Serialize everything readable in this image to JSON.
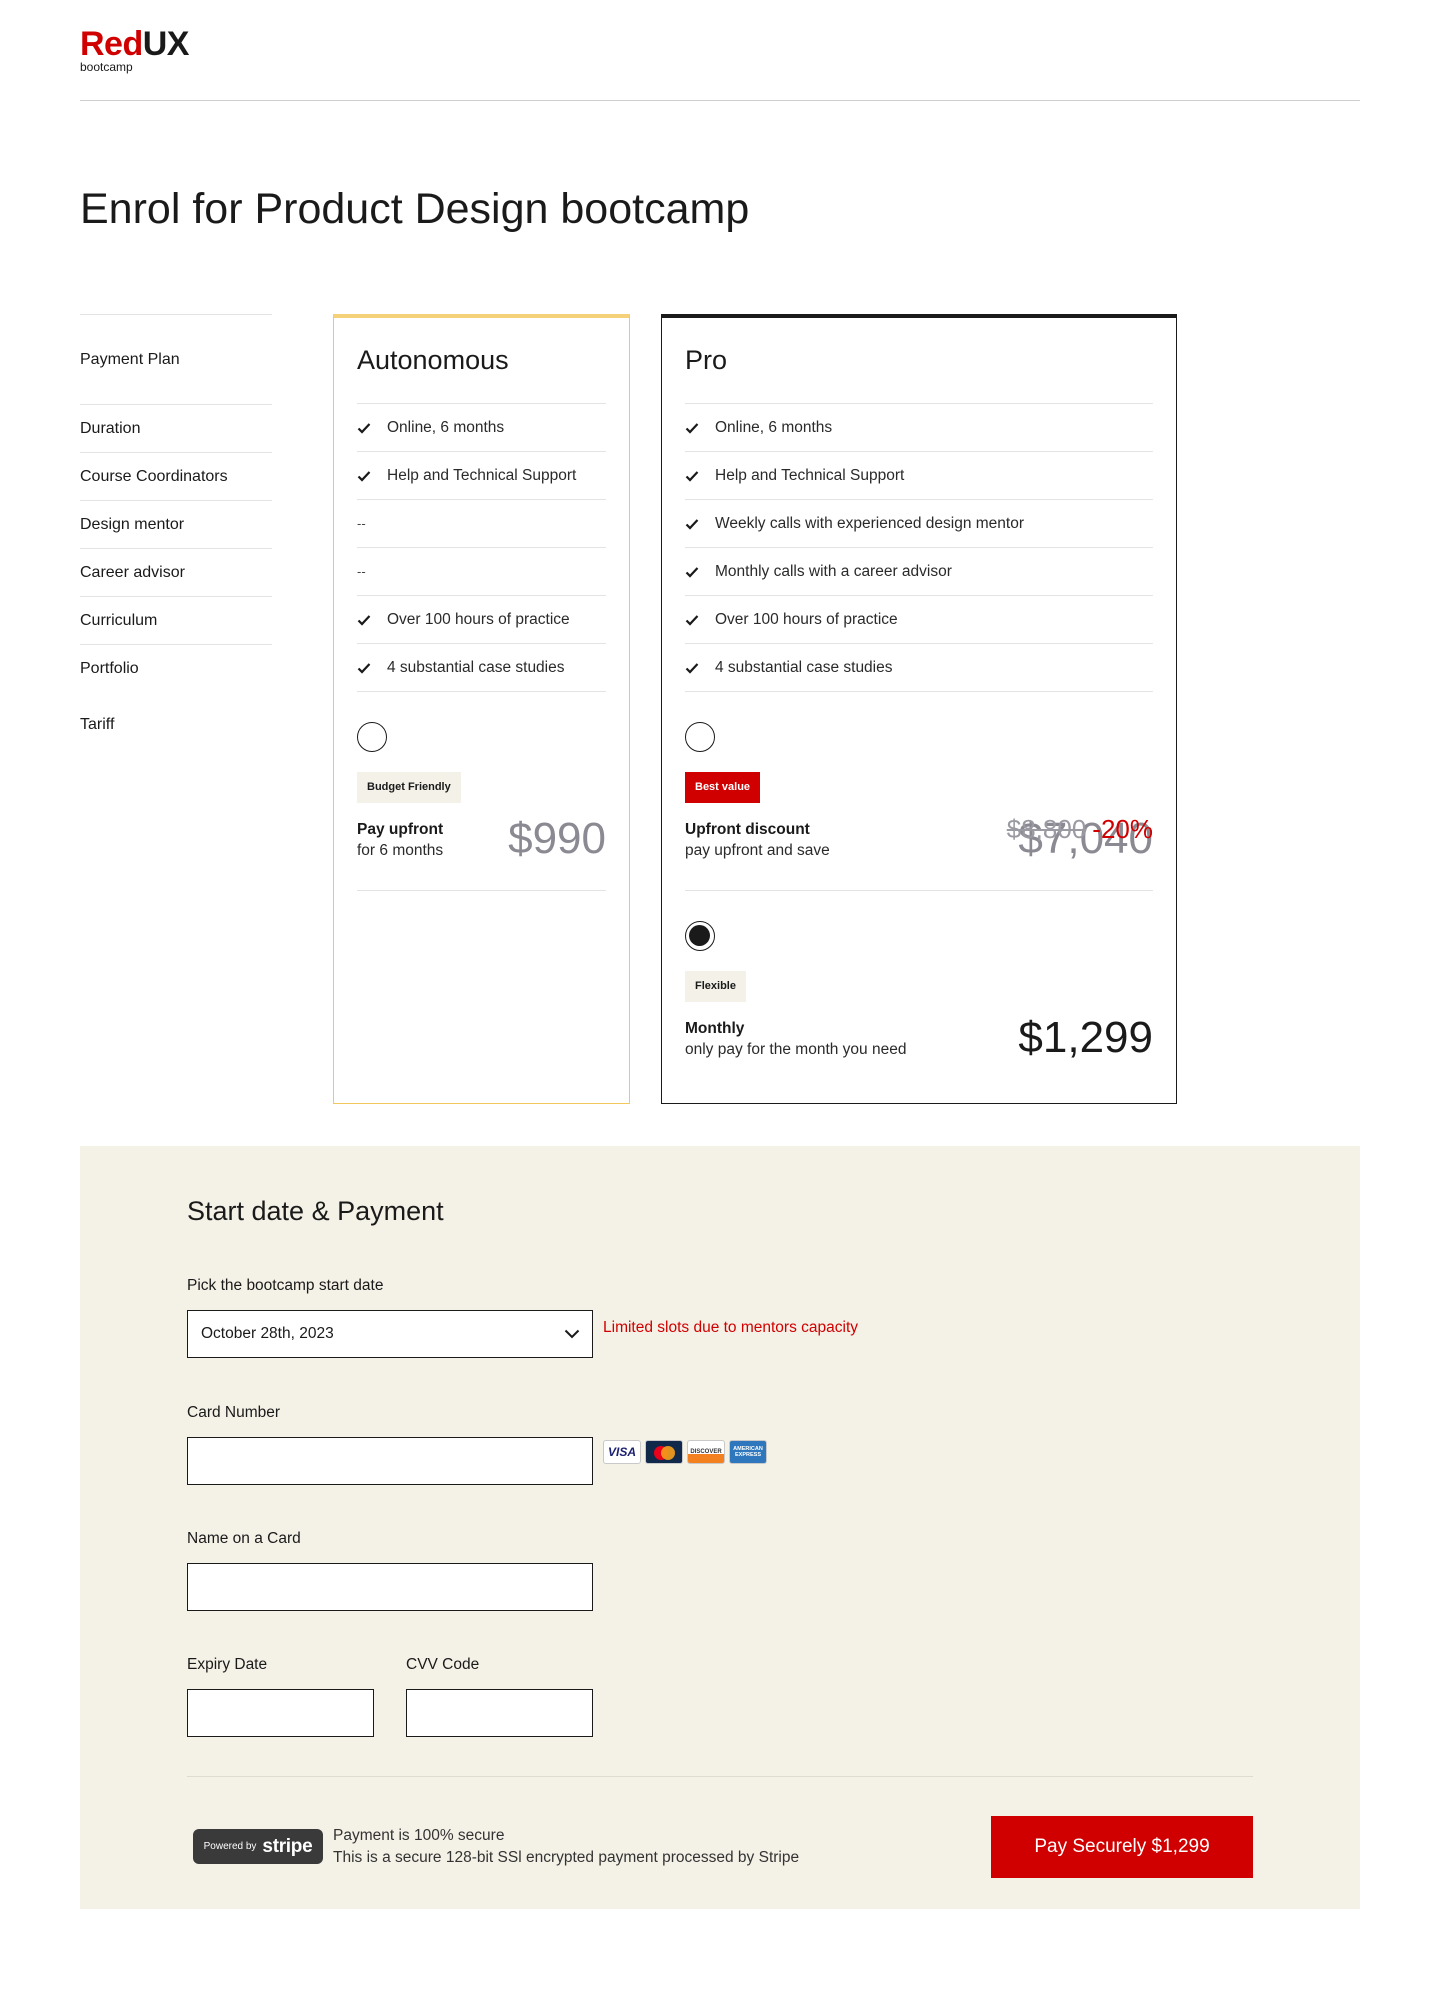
{
  "brand": {
    "name_red": "Red",
    "name_dark": "UX",
    "subtitle": "bootcamp",
    "accent_color": "#d10000"
  },
  "page": {
    "title": "Enrol for Product Design bootcamp"
  },
  "comparison": {
    "labels": [
      "Payment Plan",
      "Duration",
      "Course Coordinators",
      "Design mentor",
      "Career advisor",
      "Curriculum",
      "Portfolio",
      "Tariff"
    ],
    "plans": [
      {
        "name": "Autonomous",
        "features": [
          {
            "included": true,
            "text": "Online, 6 months"
          },
          {
            "included": true,
            "text": "Help and Technical Support"
          },
          {
            "included": false,
            "text": "--"
          },
          {
            "included": false,
            "text": "--"
          },
          {
            "included": true,
            "text": "Over 100 hours of practice"
          },
          {
            "included": true,
            "text": "4 substantial case studies"
          }
        ],
        "options": [
          {
            "selected": false,
            "tag": "Budget Friendly",
            "name": "Pay upfront",
            "desc": "for 6 months",
            "price": "$990"
          }
        ]
      },
      {
        "name": "Pro",
        "features": [
          {
            "included": true,
            "text": "Online, 6 months"
          },
          {
            "included": true,
            "text": "Help and Technical Support"
          },
          {
            "included": true,
            "text": "Weekly calls with experienced design mentor"
          },
          {
            "included": true,
            "text": "Monthly calls with a career advisor"
          },
          {
            "included": true,
            "text": "Over 100 hours of practice"
          },
          {
            "included": true,
            "text": "4 substantial case studies"
          }
        ],
        "options": [
          {
            "selected": false,
            "tag": "Best value",
            "name": "Upfront discount",
            "desc": "pay upfront and save",
            "price": "$7,040",
            "old_price": "$8,800",
            "discount": "-20%"
          },
          {
            "selected": true,
            "tag": "Flexible",
            "name": "Monthly",
            "desc": "only pay for the month you need",
            "price": "$1,299"
          }
        ]
      }
    ]
  },
  "payment": {
    "title": "Start date & Payment",
    "start_date_label": "Pick the bootcamp start date",
    "start_date_value": "October 28th, 2023",
    "limited_note": "Limited slots due to mentors capacity",
    "card_number_label": "Card Number",
    "card_number_value": "",
    "card_brands": [
      "VISA",
      "Mastercard",
      "DISCOVER",
      "AMERICAN EXPRESS"
    ],
    "name_label": "Name on a Card",
    "name_value": "",
    "expiry_label": "Expiry Date",
    "expiry_value": "",
    "cvv_label": "CVV Code",
    "cvv_value": "",
    "stripe_small": "Powered by",
    "stripe_big": "stripe",
    "secure_line1": "Payment is 100% secure",
    "secure_line2": "This is a secure 128-bit SSl encrypted payment processed by Stripe",
    "pay_button": "Pay Securely $1,299"
  }
}
